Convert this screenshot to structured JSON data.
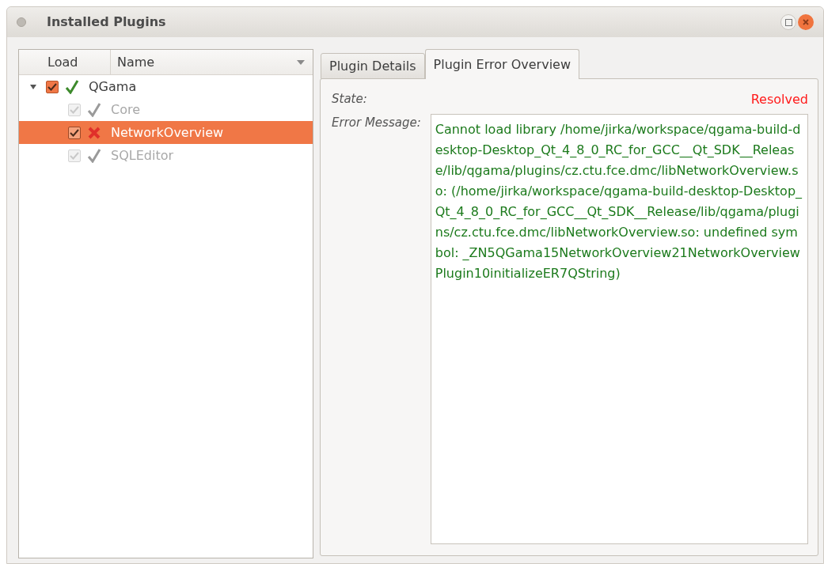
{
  "window": {
    "title": "Installed Plugins"
  },
  "tree": {
    "columns": [
      "Load",
      "Name"
    ],
    "items": [
      {
        "name": "QGama",
        "checked": true,
        "disabled": false,
        "loaded": true,
        "selected": false,
        "expanded": true,
        "children": [
          {
            "name": "Core",
            "checked": true,
            "disabled": true,
            "loaded": true,
            "selected": false
          },
          {
            "name": "NetworkOverview",
            "checked": true,
            "disabled": false,
            "loaded": false,
            "selected": true
          },
          {
            "name": "SQLEditor",
            "checked": true,
            "disabled": true,
            "loaded": true,
            "selected": false
          }
        ]
      }
    ]
  },
  "tabs": [
    {
      "label": "Plugin Details",
      "selected": false
    },
    {
      "label": "Plugin Error Overview",
      "selected": true
    }
  ],
  "details": {
    "state_label": "State:",
    "state_value": "Resolved",
    "error_label": "Error Message:",
    "error_message": "Cannot load library /home/jirka/workspace/qgama-build-desktop-Desktop_Qt_4_8_0_RC_for_GCC__Qt_SDK__Release/lib/qgama/plugins/cz.ctu.fce.dmc/libNetworkOverview.so: (/home/jirka/workspace/qgama-build-desktop-Desktop_Qt_4_8_0_RC_for_GCC__Qt_SDK__Release/lib/qgama/plugins/cz.ctu.fce.dmc/libNetworkOverview.so: undefined symbol: _ZN5QGama15NetworkOverview21NetworkOverviewPlugin10initializeER7QString)"
  }
}
